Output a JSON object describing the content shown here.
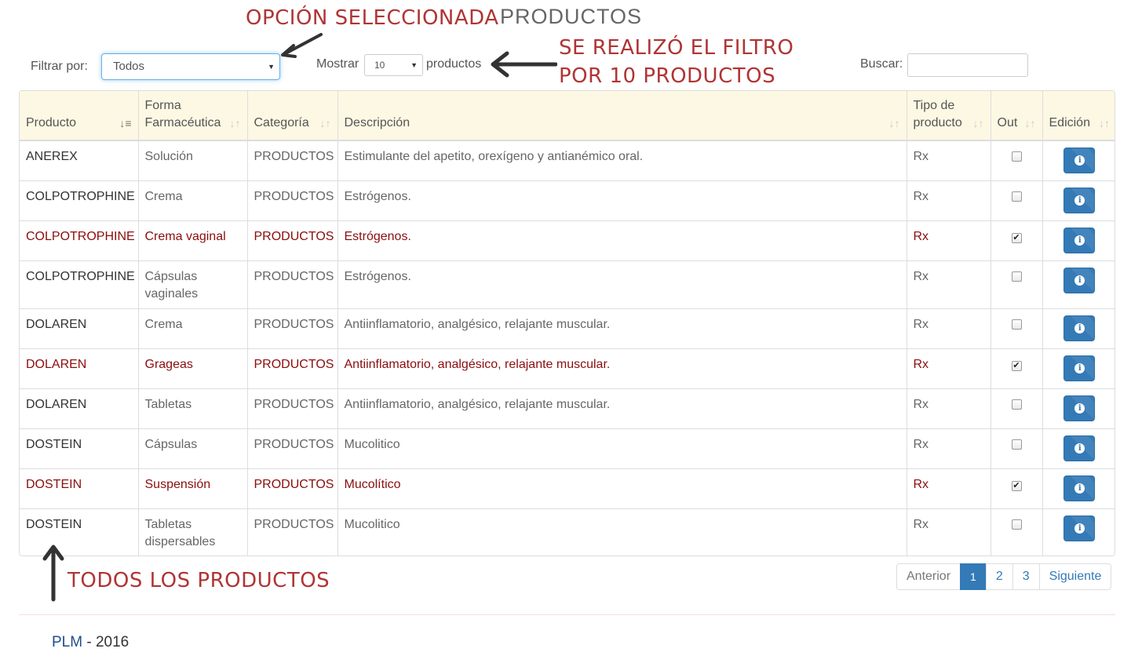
{
  "annotations": {
    "selected_option": "OPCIÓN SELECCIONADA",
    "filter_line1": "SE REALIZÓ EL FILTRO",
    "filter_line2": "POR 10 PRODUCTOS",
    "all_products": "TODOS LOS PRODUCTOS"
  },
  "page": {
    "title": "PRODUCTOS"
  },
  "filters": {
    "filter_label": "Filtrar por:",
    "filter_value": "Todos",
    "show_label": "Mostrar",
    "show_value": "10",
    "show_suffix": "productos",
    "search_label": "Buscar:",
    "search_value": ""
  },
  "table": {
    "headers": {
      "producto": "Producto",
      "forma_l1": "Forma",
      "forma_l2": "Farmacéutica",
      "categoria": "Categoría",
      "descripcion": "Descripción",
      "tipo_l1": "Tipo de",
      "tipo_l2": "producto",
      "out": "Out",
      "edicion": "Edición"
    },
    "rows": [
      {
        "producto": "ANEREX",
        "forma": "Solución",
        "categoria": "PRODUCTOS",
        "descripcion": "Estimulante del apetito, orexígeno y antianémico oral.",
        "tipo": "Rx",
        "out": false
      },
      {
        "producto": "COLPOTROPHINE",
        "forma": "Crema",
        "categoria": "PRODUCTOS",
        "descripcion": "Estrógenos.",
        "tipo": "Rx",
        "out": false
      },
      {
        "producto": "COLPOTROPHINE",
        "forma": "Crema vaginal",
        "categoria": "PRODUCTOS",
        "descripcion": "Estrógenos.",
        "tipo": "Rx",
        "out": true
      },
      {
        "producto": "COLPOTROPHINE",
        "forma": "Cápsulas vaginales",
        "categoria": "PRODUCTOS",
        "descripcion": "Estrógenos.",
        "tipo": "Rx",
        "out": false
      },
      {
        "producto": "DOLAREN",
        "forma": "Crema",
        "categoria": "PRODUCTOS",
        "descripcion": "Antiinflamatorio, analgésico, relajante muscular.",
        "tipo": "Rx",
        "out": false
      },
      {
        "producto": "DOLAREN",
        "forma": "Grageas",
        "categoria": "PRODUCTOS",
        "descripcion": "Antiinflamatorio, analgésico, relajante muscular.",
        "tipo": "Rx",
        "out": true
      },
      {
        "producto": "DOLAREN",
        "forma": "Tabletas",
        "categoria": "PRODUCTOS",
        "descripcion": "Antiinflamatorio, analgésico, relajante muscular.",
        "tipo": "Rx",
        "out": false
      },
      {
        "producto": "DOSTEIN",
        "forma": "Cápsulas",
        "categoria": "PRODUCTOS",
        "descripcion": "Mucolitico",
        "tipo": "Rx",
        "out": false
      },
      {
        "producto": "DOSTEIN",
        "forma": "Suspensión",
        "categoria": "PRODUCTOS",
        "descripcion": "Mucolítico",
        "tipo": "Rx",
        "out": true
      },
      {
        "producto": "DOSTEIN",
        "forma": "Tabletas dispersables",
        "categoria": "PRODUCTOS",
        "descripcion": "Mucolitico",
        "tipo": "Rx",
        "out": false
      }
    ]
  },
  "pagination": {
    "prev": "Anterior",
    "pages": [
      "1",
      "2",
      "3"
    ],
    "current": "1",
    "next": "Siguiente"
  },
  "footer": {
    "brand": "PLM",
    "text": " - 2016"
  },
  "colors": {
    "selected_row_text": "#8b0d0d",
    "annotation": "#b03434",
    "primary": "#337ab7",
    "header_bg": "#fcf8e3"
  }
}
